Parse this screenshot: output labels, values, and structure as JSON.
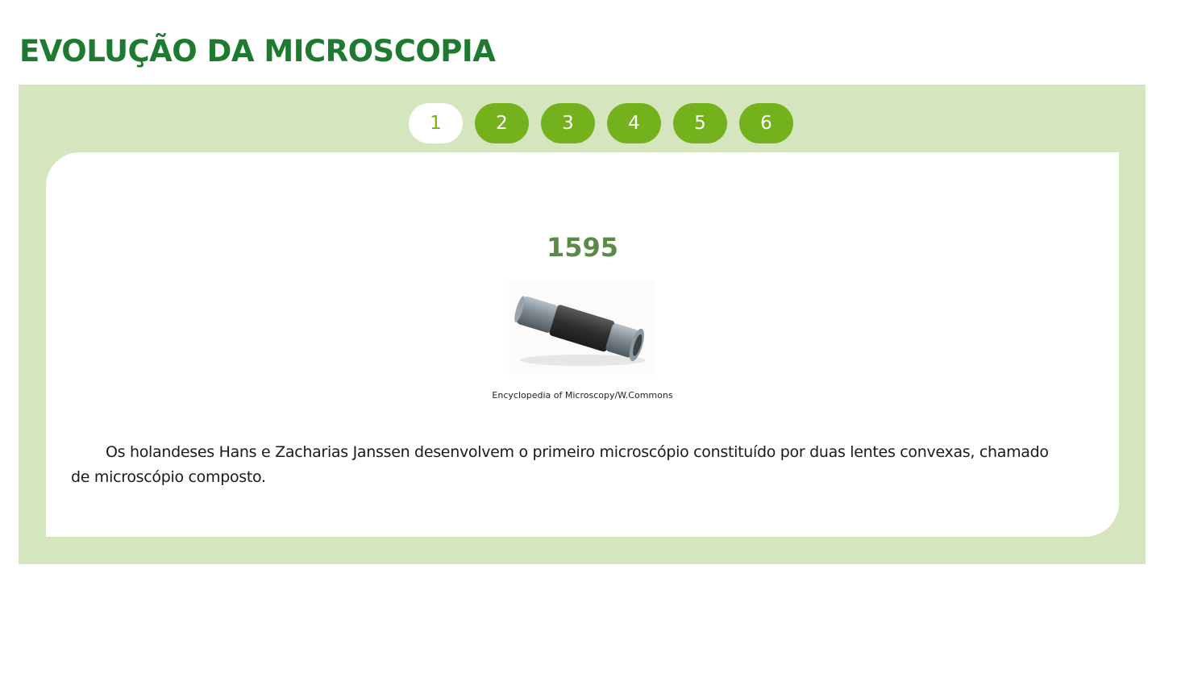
{
  "page": {
    "title": "EVOLUÇÃO DA MICROSCOPIA"
  },
  "tabs": [
    {
      "label": "1",
      "active": true
    },
    {
      "label": "2",
      "active": false
    },
    {
      "label": "3",
      "active": false
    },
    {
      "label": "4",
      "active": false
    },
    {
      "label": "5",
      "active": false
    },
    {
      "label": "6",
      "active": false
    }
  ],
  "slide": {
    "year": "1595",
    "image_alt": "microscope-tube-image",
    "caption": "Encyclopedia of Microscopy/W.Commons",
    "text": "Os holandeses Hans e Zacharias Janssen desenvolvem o primeiro microscópio constituído por duas lentes convexas, chamado de microscópio composto."
  },
  "colors": {
    "title": "#1d7a2f",
    "panel_bg": "#d5e6bf",
    "tab_bg": "#74b21d",
    "year": "#5a8a45"
  }
}
